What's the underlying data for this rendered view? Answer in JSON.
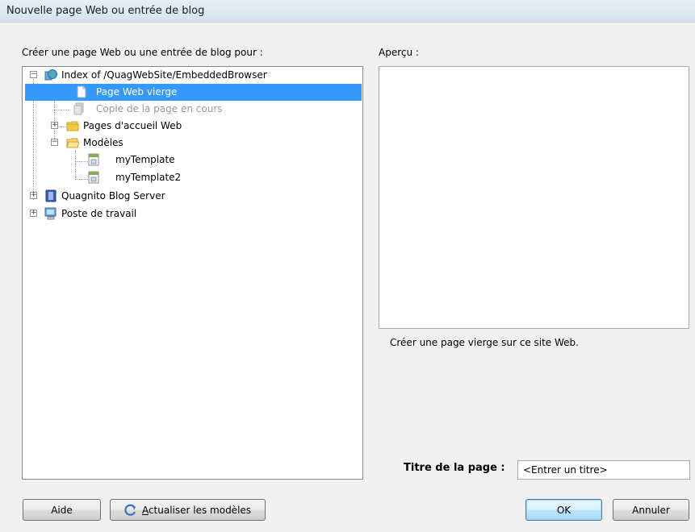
{
  "window": {
    "title": "Nouvelle page Web ou entrée de blog"
  },
  "left_panel": {
    "label": "Créer une page Web ou une entrée de blog pour :",
    "tree": [
      {
        "label": "Index of /QuagWebSite/EmbeddedBrowser",
        "icon": "globe-site-icon",
        "expander": "−"
      },
      {
        "label": "Page Web vierge",
        "icon": "blank-page-icon",
        "selected": true
      },
      {
        "label": "Copie de la page en cours",
        "icon": "copy-page-icon",
        "disabled": true
      },
      {
        "label": "Pages d'accueil Web",
        "icon": "folder-icon",
        "expander": "+"
      },
      {
        "label": "Modèles",
        "icon": "folder-open-icon",
        "expander": "−"
      },
      {
        "label": "myTemplate",
        "icon": "template-icon"
      },
      {
        "label": "myTemplate2",
        "icon": "template-icon"
      },
      {
        "label": "Quagnito Blog Server",
        "icon": "blog-server-icon",
        "expander": "+"
      },
      {
        "label": "Poste de travail",
        "icon": "computer-icon",
        "expander": "+"
      }
    ]
  },
  "right_panel": {
    "label": "Aperçu :",
    "description": "Créer une page vierge sur ce site Web.",
    "title_label": "Titre de la page :",
    "title_value": "<Entrer un titre>"
  },
  "buttons": {
    "help": "Aide",
    "refresh_prefix": "A",
    "refresh_rest": "ctualiser les modèles",
    "ok": "OK",
    "cancel": "Annuler"
  },
  "colors": {
    "selection": "#3399ff",
    "folder": "#f5c842"
  }
}
